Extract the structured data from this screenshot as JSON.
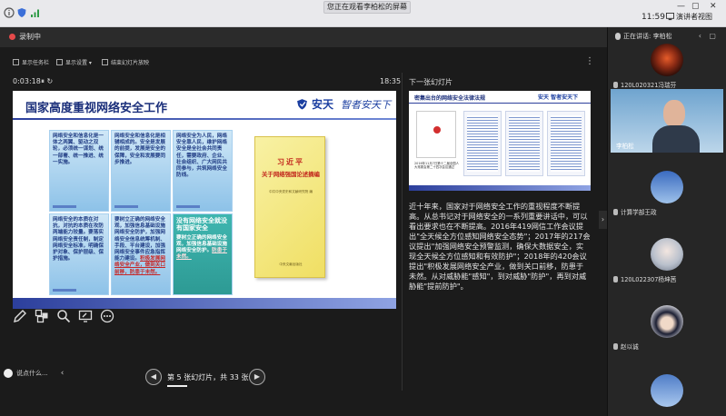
{
  "system": {
    "share_banner": "您正在观看李柏松的屏幕",
    "time": "11:59",
    "view_button": "演讲者视图"
  },
  "recording": {
    "label": "录制中"
  },
  "toolbar": {
    "show_taskbar": "显示任务栏",
    "display_settings": "显示设置 ▾",
    "end_show": "结束幻灯片放映"
  },
  "timer": {
    "elapsed": "0:03:18",
    "clock": "18:35"
  },
  "slide": {
    "title": "国家高度重视网络安全工作",
    "brand_name": "安天",
    "brand_slogan": "智者安天下",
    "cards": [
      {
        "text": "网络安全和信息化是一体之两翼、驱动之双轮，必须统一谋划、统一部署、统一推进、统一实施。"
      },
      {
        "text": "网络安全和信息化是相辅相成的。安全是发展的前提，发展是安全的保障，安全和发展要同步推进。"
      },
      {
        "text": "网络安全为人民，网络安全靠人民，维护网络安全是全社会共同责任，需要政府、企业、社会组织、广大网民共同参与，共筑网络安全防线。"
      },
      {
        "text": "网络安全的本质在对抗，对抗的本质在攻防两端能力较量。要落实网络安全责任制，制定网络安全标准，明确保护对象、保护层级、保护措施。"
      },
      {
        "text": "要树立正确的网络安全观，加强信息基础设施网络安全防护，加强网络安全信息统筹机制、手段、平台建设，加强网络安全事件应急指挥能力建设。",
        "highlight": "积极发展网络安全产业，做到关口前移，防患于未然。"
      },
      {
        "text": "没有网络安全就没有国家安全",
        "sub": "要树立正确的网络安全观，加强信息基础设施网络安全防护。",
        "highlight": "防患于未然。"
      }
    ],
    "book": {
      "author": "习近平",
      "title": "关于网络强国论述摘编",
      "publisher": "中共中央党史和文献研究院 编",
      "press": "中央文献出版社"
    }
  },
  "next": {
    "label": "下一张幻灯片",
    "title": "密集出台的网络安全法律法规",
    "brand": "安天 智者安天下",
    "cover_caption": "2016年11月7日第十二届全国人大常委会第二十四次会议通过"
  },
  "notes": "近十年来，国家对于网络安全工作的重视程度不断提高。从总书记对于网络安全的一系列重要讲话中，可以看出要求也在不断提高。2016年419网信工作会议提出\"全天候全方位感知网络安全态势\"；2017年的217会议提出\"加强网络安全预警监测，确保大数据安全，实现全天候全方位感知和有效防护\"；2018年的420会议提出\"积极发展网络安全产业，做到关口前移，防患于未然。从对威胁能\"感知\"，到对威胁\"防护\"，再到对威胁能\"提前防护\"。",
  "chat": {
    "placeholder": "说点什么..."
  },
  "pager": {
    "text": "第 5 张幻灯片，共 33 张",
    "prev": "◀",
    "next": "▶"
  },
  "people": {
    "speaking": "正在讲话: 李柏松",
    "list": [
      {
        "name": "120L020321冯瑞芬",
        "avatar": "#5a1a12"
      },
      {
        "name": "李柏松",
        "avatar": ""
      },
      {
        "name": "计算学部王政",
        "avatar": "#4f79c2"
      },
      {
        "name": "120L022307杨坤茜",
        "avatar": "#d8dde6"
      },
      {
        "name": "赵以诚",
        "avatar": "#f0f0f2"
      },
      {
        "name": "",
        "avatar": "#6a8ec8"
      }
    ]
  }
}
